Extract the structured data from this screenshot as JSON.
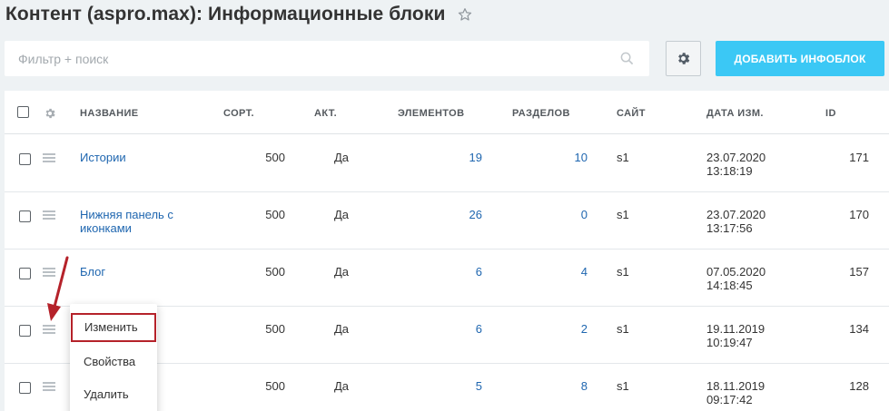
{
  "header": {
    "title": "Контент (aspro.max): Информационные блоки"
  },
  "toolbar": {
    "filter_placeholder": "Фильтр + поиск",
    "add_label": "ДОБАВИТЬ ИНФОБЛОК"
  },
  "colors": {
    "accent": "#3bc8f5",
    "link": "#2067b0",
    "highlight": "#b5222a"
  },
  "icons": [
    "star-icon",
    "search-icon",
    "gear-icon",
    "drag-handle-icon",
    "arrow-icon"
  ],
  "table": {
    "columns": [
      "НАЗВАНИЕ",
      "СОРТ.",
      "АКТ.",
      "ЭЛЕМЕНТОВ",
      "РАЗДЕЛОВ",
      "САЙТ",
      "ДАТА ИЗМ.",
      "ID"
    ],
    "rows": [
      {
        "name": "Истории",
        "sort": "500",
        "active": "Да",
        "elements": "19",
        "sections": "10",
        "site": "s1",
        "date": "23.07.2020",
        "time": "13:18:19",
        "id": "171"
      },
      {
        "name": "Нижняя панель с иконками",
        "sort": "500",
        "active": "Да",
        "elements": "26",
        "sections": "0",
        "site": "s1",
        "date": "23.07.2020",
        "time": "13:17:56",
        "id": "170"
      },
      {
        "name": "Блог",
        "sort": "500",
        "active": "Да",
        "elements": "6",
        "sections": "4",
        "site": "s1",
        "date": "07.05.2020",
        "time": "14:18:45",
        "id": "157"
      },
      {
        "name": "",
        "sort": "500",
        "active": "Да",
        "elements": "6",
        "sections": "2",
        "site": "s1",
        "date": "19.11.2019",
        "time": "10:19:47",
        "id": "134"
      },
      {
        "name": "",
        "sort": "500",
        "active": "Да",
        "elements": "5",
        "sections": "8",
        "site": "s1",
        "date": "18.11.2019",
        "time": "09:17:42",
        "id": "128"
      }
    ]
  },
  "context_menu": {
    "items": [
      "Изменить",
      "Свойства",
      "Удалить"
    ],
    "active_item": "Изменить"
  }
}
